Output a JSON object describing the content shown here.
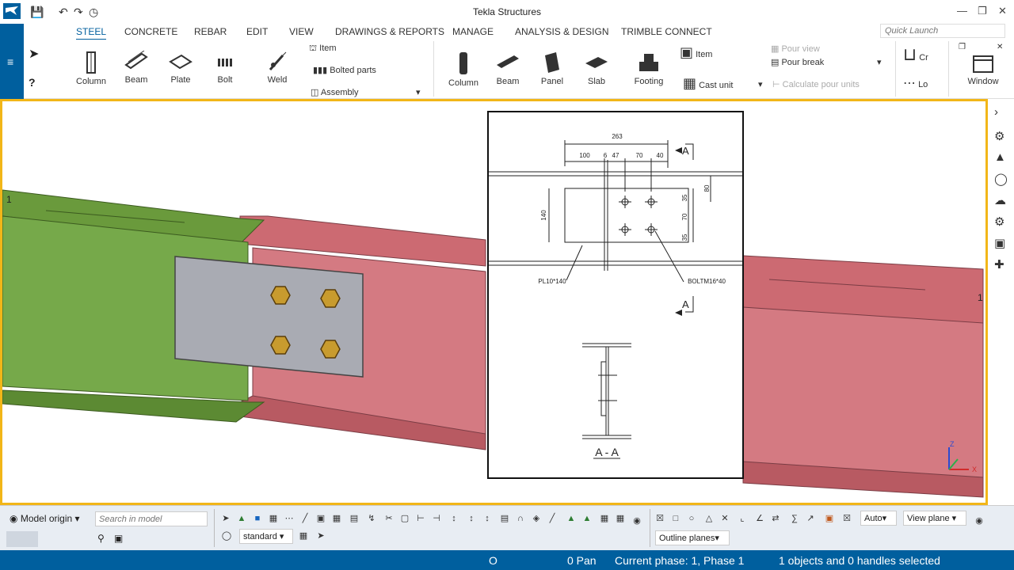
{
  "app": {
    "title": "Tekla Structures"
  },
  "tabs": [
    "STEEL",
    "CONCRETE",
    "REBAR",
    "EDIT",
    "VIEW",
    "DRAWINGS & REPORTS",
    "MANAGE",
    "ANALYSIS & DESIGN",
    "TRIMBLE CONNECT"
  ],
  "quick_launch": {
    "placeholder": "Quick Launch"
  },
  "steel": {
    "column": "Column",
    "beam": "Beam",
    "plate": "Plate",
    "bolt": "Bolt",
    "weld": "Weld",
    "item": "Item",
    "bolted_parts": "Bolted parts",
    "assembly": "Assembly"
  },
  "concrete": {
    "column": "Column",
    "beam": "Beam",
    "panel": "Panel",
    "slab": "Slab",
    "footing": "Footing",
    "item": "Item",
    "cast_unit": "Cast unit",
    "pour_view": "Pour view",
    "pour_break": "Pour break",
    "calculate_pour_units": "Calculate pour units"
  },
  "extra": {
    "cr": "Cr",
    "lo": "Lo",
    "window": "Window"
  },
  "model": {
    "grid_label_left": "1",
    "grid_label_right": "1"
  },
  "drawing": {
    "dims": {
      "overall": "263",
      "d100": "100",
      "d6": "6",
      "d47": "47",
      "d70": "70",
      "d40": "40",
      "d80": "80",
      "d35a": "35",
      "d70v": "70",
      "d35b": "35",
      "d140": "140"
    },
    "section_mark": "A",
    "plate_label": "PL10*140",
    "bolt_label": "BOLTM16*40",
    "section_title": "A - A"
  },
  "axes": {
    "z": "Z",
    "x": "X"
  },
  "bottom": {
    "model_origin": "Model origin",
    "search_placeholder": "Search in model",
    "standard": "standard",
    "auto": "Auto",
    "view_plane": "View plane",
    "outline_planes": "Outline planes"
  },
  "status": {
    "o": "O",
    "pan": "0 Pan",
    "phase": "Current phase: 1, Phase 1",
    "selection": "1 objects and 0 handles selected"
  },
  "colors": {
    "brand": "#005f9e",
    "viewport_border": "#f2b618",
    "green_beam": "#6a9a3c",
    "red_beam": "#cc6a72",
    "plate": "#a9abb3",
    "bolt": "#c89b2e"
  }
}
